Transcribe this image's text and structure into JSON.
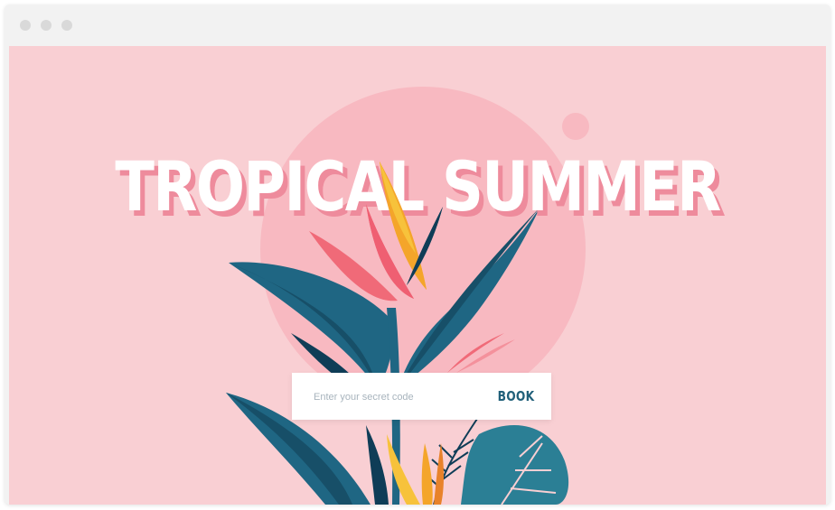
{
  "page": {
    "headline": "TROPICAL SUMMER"
  },
  "booking": {
    "placeholder": "Enter your secret code",
    "value": "",
    "button_label": "BOOK"
  },
  "colors": {
    "background": "#f9cfd3",
    "sun": "#f8b9c1",
    "leaf_teal": "#1f5f7a",
    "leaf_dark": "#0f3d57",
    "petal_pink": "#f06a78",
    "petal_orange": "#f4a52a",
    "headline_shadow": "#ee8b9c",
    "button_text": "#21607a"
  }
}
